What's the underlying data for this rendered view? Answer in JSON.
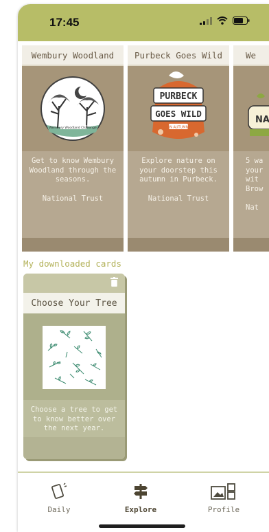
{
  "status_bar": {
    "time": "17:45"
  },
  "cards": [
    {
      "title": "Wembury Woodland",
      "description": "Get to know Wembury Woodland through the seasons.",
      "organization": "National Trust",
      "logo_text": "Wembury Woodland Challenge"
    },
    {
      "title": "Purbeck Goes Wild",
      "description": "Explore nature on your doorstep this autumn in Purbeck.",
      "organization": "National Trust",
      "logo_line1": "PURBECK",
      "logo_line2": "GOES WILD",
      "logo_tag": "IN AUTUMN"
    },
    {
      "title": "We",
      "description": "5 wa your wit Brow",
      "organization": "Nat",
      "logo_text": "NA"
    }
  ],
  "downloaded": {
    "section_title": "My downloaded cards",
    "card": {
      "title": "Choose Your Tree",
      "description": "Choose a tree to get to know better over the next year."
    }
  },
  "tabs": [
    {
      "label": "Daily",
      "icon": "daily-cards-icon"
    },
    {
      "label": "Explore",
      "icon": "signpost-icon"
    },
    {
      "label": "Profile",
      "icon": "profile-grid-icon"
    }
  ],
  "colors": {
    "status_bar": "#b7bd67",
    "card_brown": "#a0917a",
    "card_sage": "#c7c7a6",
    "section_title": "#b3b25a"
  }
}
